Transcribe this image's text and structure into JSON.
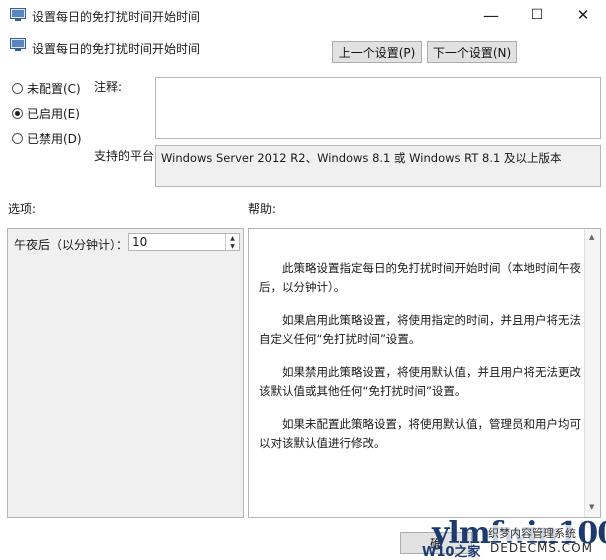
{
  "window": {
    "title": "设置每日的免打扰时间开始时间",
    "minimize_glyph": "—",
    "maximize_glyph": "☐",
    "close_glyph": "✕"
  },
  "header": {
    "setting_name": "设置每日的免打扰时间开始时间",
    "prev_label": "上一个设置(P)",
    "next_label": "下一个设置(N)"
  },
  "state": {
    "options": [
      {
        "label": "未配置(C)",
        "selected": false
      },
      {
        "label": "已启用(E)",
        "selected": true
      },
      {
        "label": "已禁用(D)",
        "selected": false
      }
    ]
  },
  "comment": {
    "label": "注释:",
    "value": ""
  },
  "platform": {
    "label": "支持的平台:",
    "value": "Windows Server 2012 R2、Windows 8.1 或 Windows RT 8.1 及以上版本"
  },
  "options_section": {
    "label": "选项:",
    "field_label": "午夜后（以分钟计）：",
    "field_value": "10"
  },
  "help_section": {
    "label": "帮助:",
    "paragraphs": [
      "此策略设置指定每日的免打扰时间开始时间（本地时间午夜后，以分钟计）。",
      "如果启用此策略设置，将使用指定的时间，并且用户将无法自定义任何“免打扰时间”设置。",
      "如果禁用此策略设置，将使用默认值，并且用户将无法更改该默认值或其他任何“免打扰时间”设置。",
      "如果未配置此策略设置，将使用默认值，管理员和用户均可以对该默认值进行修改。"
    ]
  },
  "footer": {
    "ok_label": "确"
  },
  "watermark": {
    "brand": "ylmfwin100",
    "site_cn": "织梦内容管理系统",
    "w10": "W10之家",
    "url": "DEDECMS.COM"
  }
}
